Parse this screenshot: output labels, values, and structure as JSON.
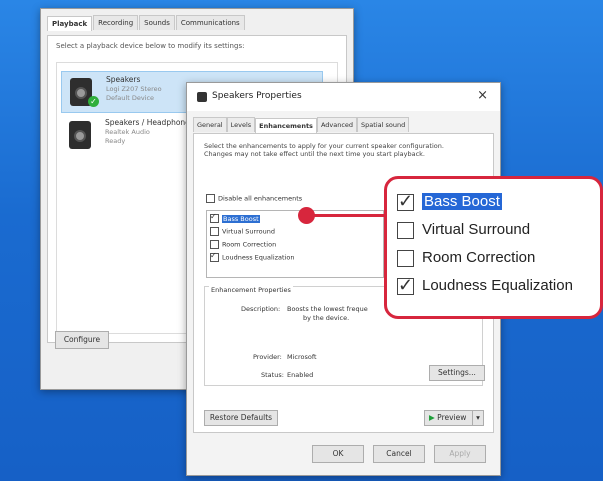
{
  "sound_dialog": {
    "tabs": [
      "Playback",
      "Recording",
      "Sounds",
      "Communications"
    ],
    "instruction": "Select a playback device below to modify its settings:",
    "devices": [
      {
        "name": "Speakers",
        "line1": "Logi Z207 Stereo",
        "line2": "Default Device",
        "selected": true
      },
      {
        "name": "Speakers / Headphones",
        "line1": "Realtek Audio",
        "line2": "Ready",
        "selected": false
      }
    ],
    "configure_label": "Configure"
  },
  "properties": {
    "title": "Speakers Properties",
    "close_glyph": "×",
    "tabs": [
      "General",
      "Levels",
      "Enhancements",
      "Advanced",
      "Spatial sound"
    ],
    "description": "Select the enhancements to apply for your current speaker configuration. Changes may not take effect until the next time you start playback.",
    "disable_all_label": "Disable all enhancements",
    "enhancements": [
      {
        "label": "Bass Boost",
        "checked": true,
        "highlighted": true
      },
      {
        "label": "Virtual Surround",
        "checked": false,
        "highlighted": false
      },
      {
        "label": "Room Correction",
        "checked": false,
        "highlighted": false
      },
      {
        "label": "Loudness Equalization",
        "checked": true,
        "highlighted": false
      }
    ],
    "group_label": "Enhancement Properties",
    "description_key": "Description:",
    "description_value_line1": "Boosts the lowest freque",
    "description_value_line2": "by the device.",
    "provider_key": "Provider:",
    "provider_value": "Microsoft",
    "status_key": "Status:",
    "status_value": "Enabled",
    "settings_label": "Settings...",
    "restore_label": "Restore Defaults",
    "preview_label": "Preview",
    "ok_label": "OK",
    "cancel_label": "Cancel",
    "apply_label": "Apply"
  },
  "zoom_callout": {
    "items": [
      {
        "label": "Bass Boost",
        "checked": true,
        "highlighted": true
      },
      {
        "label": "Virtual Surround",
        "checked": false,
        "highlighted": false
      },
      {
        "label": "Room Correction",
        "checked": false,
        "highlighted": false
      },
      {
        "label": "Loudness Equalization",
        "checked": true,
        "highlighted": false
      }
    ]
  },
  "colors": {
    "accent": "#d7263d",
    "highlight": "#2567d6",
    "desktop": "#1c6fd0"
  }
}
